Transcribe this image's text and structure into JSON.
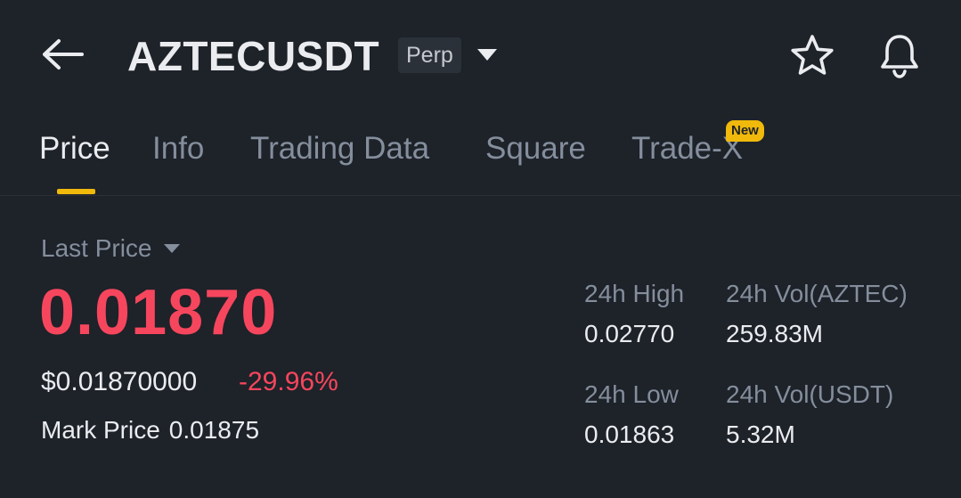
{
  "header": {
    "symbol": "AZTECUSDT",
    "contract_type": "Perp"
  },
  "tabs": [
    {
      "label": "Price",
      "active": true
    },
    {
      "label": "Info",
      "active": false
    },
    {
      "label": "Trading Data",
      "active": false
    },
    {
      "label": "Square",
      "active": false
    },
    {
      "label": "Trade-X",
      "active": false,
      "badge": "New"
    }
  ],
  "price": {
    "label": "Last Price",
    "last_price": "0.01870",
    "usd_price": "$0.01870000",
    "change_pct": "-29.96%",
    "mark_label": "Mark Price",
    "mark_price": "0.01875"
  },
  "stats": {
    "high_label": "24h High",
    "high_value": "0.02770",
    "vol_base_label": "24h Vol(AZTEC)",
    "vol_base_value": "259.83M",
    "low_label": "24h Low",
    "low_value": "0.01863",
    "vol_quote_label": "24h Vol(USDT)",
    "vol_quote_value": "5.32M"
  },
  "colors": {
    "background": "#1e2229",
    "text_primary": "#eaecef",
    "text_secondary": "#848e9c",
    "negative": "#f6465d",
    "accent": "#f0b90b",
    "badge_bg": "#2b3139"
  },
  "icons": {
    "back": "arrow-left-icon",
    "dropdown": "caret-down-icon",
    "favorite": "star-icon",
    "alert": "bell-icon"
  }
}
